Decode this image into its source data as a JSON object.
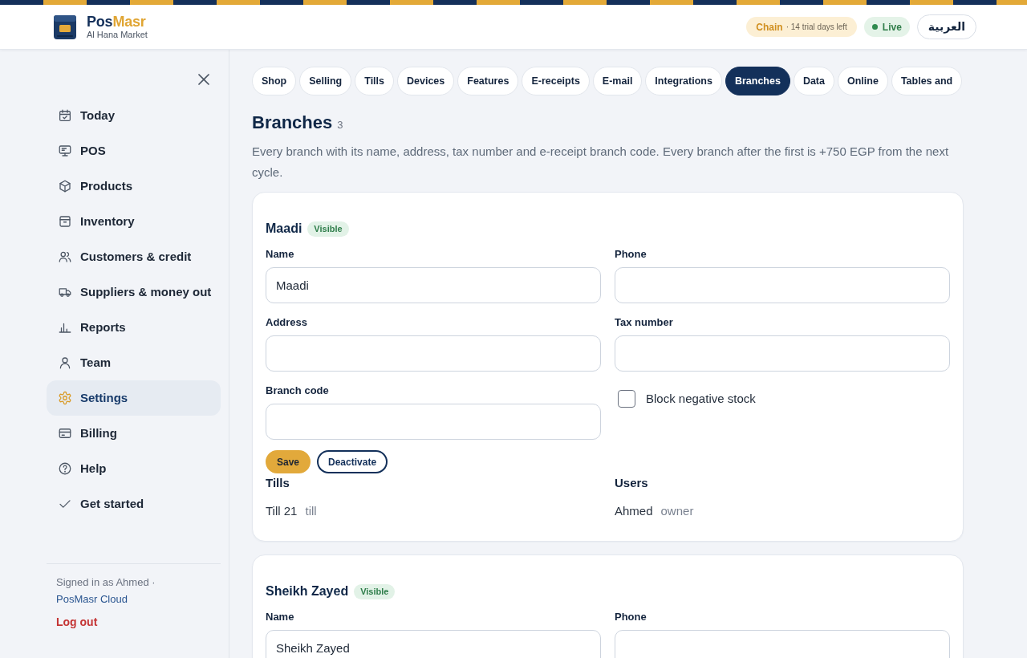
{
  "header": {
    "brand_parts": [
      "Pos",
      "Masr"
    ],
    "store": "Al Hana Market",
    "plan": {
      "name": "Chain",
      "note": "· 14 trial days left"
    },
    "status": {
      "label": "Live"
    },
    "language": "العربية"
  },
  "sidebar": {
    "items": [
      {
        "label": "Today",
        "selected": false
      },
      {
        "label": "POS",
        "selected": false
      },
      {
        "label": "Products",
        "selected": false
      },
      {
        "label": "Inventory",
        "selected": false
      },
      {
        "label": "Customers & credit",
        "selected": false
      },
      {
        "label": "Suppliers & money out",
        "selected": false
      },
      {
        "label": "Reports",
        "selected": false
      },
      {
        "label": "Team",
        "selected": false
      },
      {
        "label": "Settings",
        "selected": true
      },
      {
        "label": "Billing",
        "selected": false
      },
      {
        "label": "Help",
        "selected": false
      },
      {
        "label": "Get started",
        "selected": false
      }
    ],
    "footer": {
      "signed_in": "Signed in as Ahmed ·",
      "link": "PosMasr Cloud",
      "logout": "Log out"
    }
  },
  "tabs": [
    {
      "label": "Shop",
      "selected": false
    },
    {
      "label": "Selling",
      "selected": false
    },
    {
      "label": "Tills",
      "selected": false
    },
    {
      "label": "Devices",
      "selected": false
    },
    {
      "label": "Features",
      "selected": false
    },
    {
      "label": "E-receipts",
      "selected": false
    },
    {
      "label": "E-mail",
      "selected": false
    },
    {
      "label": "Integrations",
      "selected": false
    },
    {
      "label": "Branches",
      "selected": true
    },
    {
      "label": "Data",
      "selected": false
    },
    {
      "label": "Online",
      "selected": false
    },
    {
      "label": "Tables and",
      "selected": false
    }
  ],
  "section": {
    "title": "Branches",
    "count": "3",
    "description": "Every branch with its name, address, tax number and e-receipt branch code. Every branch after the first is +750 EGP from the next cycle."
  },
  "branches": [
    {
      "name": "Maadi",
      "status": "Visible",
      "fields": [
        {
          "kind": "text",
          "label": "Name",
          "value": "Maadi"
        },
        {
          "kind": "text",
          "label": "Phone"
        },
        {
          "kind": "text",
          "label": "Address"
        },
        {
          "kind": "text",
          "label": "Tax number"
        },
        {
          "kind": "text",
          "label": "Branch code"
        },
        {
          "kind": "checkbox",
          "label": "Block negative stock",
          "checked": false
        }
      ],
      "buttons": [
        {
          "kind": "primary",
          "label": "Save"
        },
        {
          "kind": "outline",
          "label": "Deactivate"
        }
      ],
      "lists": [
        {
          "title": "Tills",
          "items": [
            {
              "name": "Till 21",
              "detail": "till"
            }
          ]
        },
        {
          "title": "Users",
          "items": [
            {
              "name": "Ahmed",
              "detail": "owner"
            }
          ]
        }
      ]
    },
    {
      "name": "Sheikh Zayed",
      "status": "Visible",
      "fields": [
        {
          "kind": "text",
          "label": "Name",
          "value": "Sheikh Zayed"
        },
        {
          "kind": "text",
          "label": "Phone"
        }
      ]
    }
  ]
}
